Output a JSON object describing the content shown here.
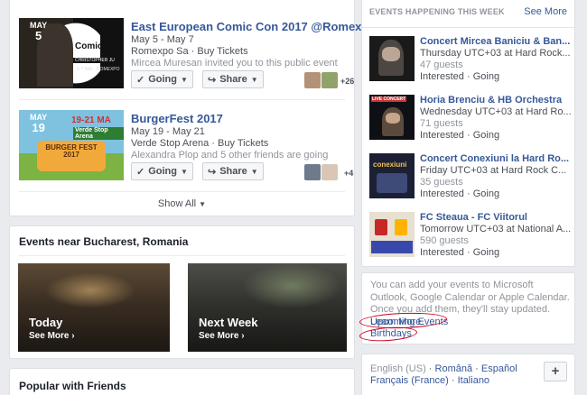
{
  "events": [
    {
      "title": "East European Comic Con 2017 @Romex...",
      "dates": "May 5 - May 7",
      "venue": "Romexpo Sa · Buy Tickets",
      "invite": "Mircea Muresan invited you to this public event",
      "badge_month": "MAY",
      "badge_day": "5",
      "going": "Going",
      "share": "Share",
      "friend_count": "+26",
      "thumb_text": "Comic Co",
      "thumb_sub": "CHRISTOPHER JU",
      "thumb_dates": "5-7 MAI · ROMEXPO"
    },
    {
      "title": "BurgerFest 2017",
      "dates": "May 19 - May 21",
      "venue": "Verde Stop Arena · Buy Tickets",
      "invite": "Alexandra Plop and 5 other friends are going",
      "badge_month": "MAY",
      "badge_day": "19",
      "going": "Going",
      "share": "Share",
      "friend_count": "+4",
      "thumb_text": "BURGER FEST 2017",
      "thumb_dates": "19-21 MA",
      "thumb_venue": "Verde Stop Arena"
    }
  ],
  "show_all": "Show All",
  "near": {
    "title": "Events near Bucharest, Romania",
    "tiles": [
      {
        "label": "Today",
        "more": "See More"
      },
      {
        "label": "Next Week",
        "more": "See More"
      }
    ]
  },
  "popular": {
    "title": "Popular with Friends"
  },
  "week": {
    "header": "EVENTS HAPPENING THIS WEEK",
    "see_more": "See More",
    "items": [
      {
        "title": "Concert Mircea Baniciu & Ban...",
        "when": "Thursday UTC+03 at Hard Rock...",
        "guests": "47 guests",
        "interested": "Interested",
        "going": "Going"
      },
      {
        "title": "Horia Brenciu & HB Orchestra",
        "when": "Wednesday UTC+03 at Hard Ro...",
        "guests": "71 guests",
        "interested": "Interested",
        "going": "Going",
        "thumb_tag": "LIVE CONCERT"
      },
      {
        "title": "Concert Conexiuni la Hard Ro...",
        "when": "Friday UTC+03 at Hard Rock C...",
        "guests": "35 guests",
        "interested": "Interested",
        "going": "Going",
        "thumb_tag": "conexiuni"
      },
      {
        "title": "FC Steaua - FC Viitorul",
        "when": "Tomorrow UTC+03 at National A...",
        "guests": "590 guests",
        "interested": "Interested",
        "going": "Going"
      }
    ]
  },
  "calendar": {
    "text": "You can add your events to Microsoft Outlook, Google Calendar or Apple Calendar. Once you add them, they'll stay updated.",
    "learn_more": "Learn More.",
    "upcoming": "Upcoming Events",
    "birthdays": "Birthdays"
  },
  "languages": {
    "current": "English (US)",
    "items": [
      "Română",
      "Español",
      "Français (France)",
      "Italiano"
    ],
    "add": "+"
  }
}
